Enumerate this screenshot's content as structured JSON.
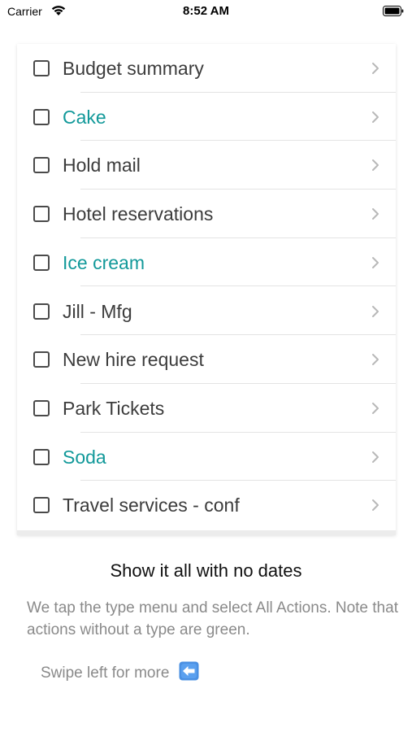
{
  "status_bar": {
    "carrier": "Carrier",
    "time": "8:52 AM",
    "icons": [
      "wifi-icon",
      "battery-icon"
    ]
  },
  "actions_list": {
    "items": [
      {
        "label": "Budget summary",
        "checked": false,
        "color": "#3c3c3c"
      },
      {
        "label": "Cake",
        "checked": false,
        "color": "#12999a"
      },
      {
        "label": "Hold mail",
        "checked": false,
        "color": "#3c3c3c"
      },
      {
        "label": "Hotel reservations",
        "checked": false,
        "color": "#3c3c3c"
      },
      {
        "label": "Ice cream",
        "checked": false,
        "color": "#12999a"
      },
      {
        "label": "Jill - Mfg",
        "checked": false,
        "color": "#3c3c3c"
      },
      {
        "label": "New hire request",
        "checked": false,
        "color": "#3c3c3c"
      },
      {
        "label": "Park Tickets",
        "checked": false,
        "color": "#3c3c3c"
      },
      {
        "label": "Soda",
        "checked": false,
        "color": "#12999a"
      },
      {
        "label": "Travel services - conf",
        "checked": false,
        "color": "#3c3c3c"
      }
    ]
  },
  "caption": {
    "title": "Show it all with no dates",
    "body": "We tap the type menu and select All Actions. Note that actions without a type are green.",
    "swipe_hint": "Swipe left for more",
    "swipe_icon": "left-arrow-icon"
  },
  "colors": {
    "untyped_action": "#12999a",
    "typed_action": "#3c3c3c",
    "caption_text": "#8a8a8a",
    "arrow_icon_bg": "#4a90e2"
  }
}
